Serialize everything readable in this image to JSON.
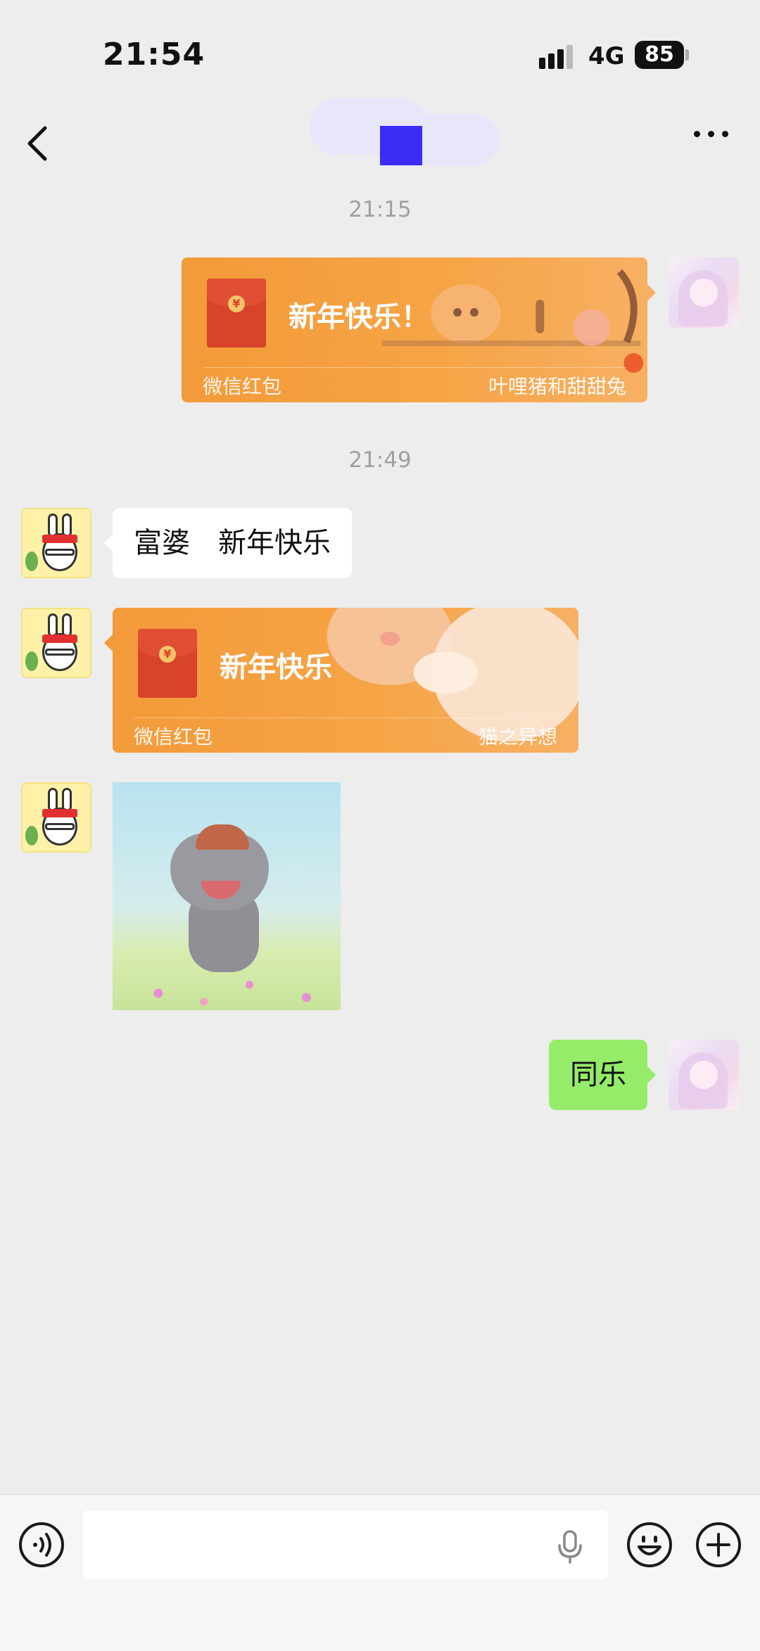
{
  "status_bar": {
    "time": "21:54",
    "network": "4G",
    "battery": "85"
  },
  "nav": {
    "title": ""
  },
  "messages": {
    "ts1": "21:15",
    "rp1": {
      "greeting": "新年快乐！",
      "brand": "微信红包",
      "sender": "叶哩猪和甜甜兔"
    },
    "ts2": "21:49",
    "text1": "富婆　新年快乐",
    "rp2": {
      "greeting": "新年快乐",
      "brand": "微信红包",
      "sender": "猫之异想"
    },
    "reply": "同乐"
  },
  "input_bar": {
    "placeholder": ""
  },
  "icons": {
    "back": "chevron-left-icon",
    "more": "more-icon",
    "voice": "voice-icon",
    "mic": "microphone-icon",
    "emoji": "emoji-icon",
    "add": "plus-icon",
    "coin": "yuan-icon"
  },
  "colors": {
    "background": "#ededed",
    "red_packet": "#f39a3a",
    "green_bubble": "#95ec69",
    "title_mask": "#3a2cf5"
  }
}
